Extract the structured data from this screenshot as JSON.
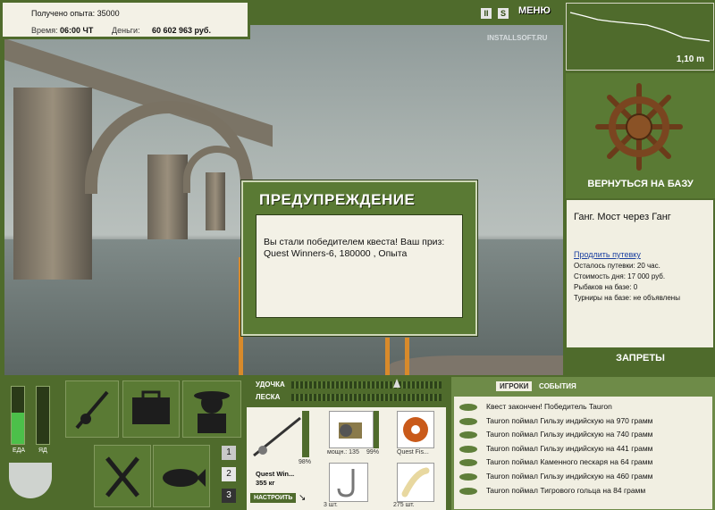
{
  "stats": {
    "experience_label": "Получено опыта: 35000",
    "time_label": "Время:",
    "time_value": "06:00 ЧТ",
    "money_label": "Деньги:",
    "money_value": "60 602 963 руб."
  },
  "top_buttons": {
    "pause": "II",
    "sound": "S",
    "menu": "МЕНЮ"
  },
  "watermark": "INSTALLSOFT.RU",
  "depth": {
    "value": "1,10 m"
  },
  "right_panel": {
    "return_label": "ВЕРНУТЬСЯ НА БАЗУ",
    "location_title": "Ганг. Мост через Ганг",
    "extend_link": "Продлить путевку",
    "trip_left": "Осталось путевки: 20 час.",
    "day_cost": "Стоимость дня: 17 000 руб.",
    "fishers": "Рыбаков на базе: 0",
    "tournaments": "Турниры на базе: не объявлены",
    "bans_label": "ЗАПРЕТЫ"
  },
  "dialog": {
    "title": "ПРЕДУПРЕЖДЕНИЕ",
    "message": "Вы стали победителем квеста! Ваш приз: Quest Winners-6, 180000 , Опыта"
  },
  "needs": {
    "food_label": "ЕДА",
    "poison_label": "ЯД",
    "food_level": 0.55,
    "poison_level": 0.0
  },
  "slots": {
    "page1": "1",
    "page2": "2",
    "page3": "3"
  },
  "gear": {
    "rod_label": "УДОЧКА",
    "line_label": "ЛЕСКА",
    "rod_name": "Quest Win...",
    "rod_capacity": "355 кг",
    "rod_wear": "98%",
    "configure_button": "НАСТРОИТЬ",
    "reel_power": "мощн.: 135",
    "reel_wear": "99%",
    "line_name": "Quest Fis...",
    "hook_count": "3 шт.",
    "bait_count": "275 шт."
  },
  "log": {
    "tab_players": "ИГРОКИ",
    "tab_events": "СОБЫТИЯ",
    "entries": [
      "Квест закончен! Победитель Tauron",
      "Tauron поймал Гильзу индийскую на 970 грамм",
      "Tauron поймал Гильзу индийскую на 740 грамм",
      "Tauron поймал Гильзу индийскую на 441 грамм",
      "Tauron поймал Каменного пескаря на 64 грамм",
      "Tauron поймал Гильзу индийскую на 460 грамм",
      "Tauron поймал Тигрового гольца на 84 грамм"
    ]
  },
  "colors": {
    "panel_green": "#4f6b2c",
    "dialog_green": "#5a7a34",
    "cream": "#f3f1e6"
  }
}
